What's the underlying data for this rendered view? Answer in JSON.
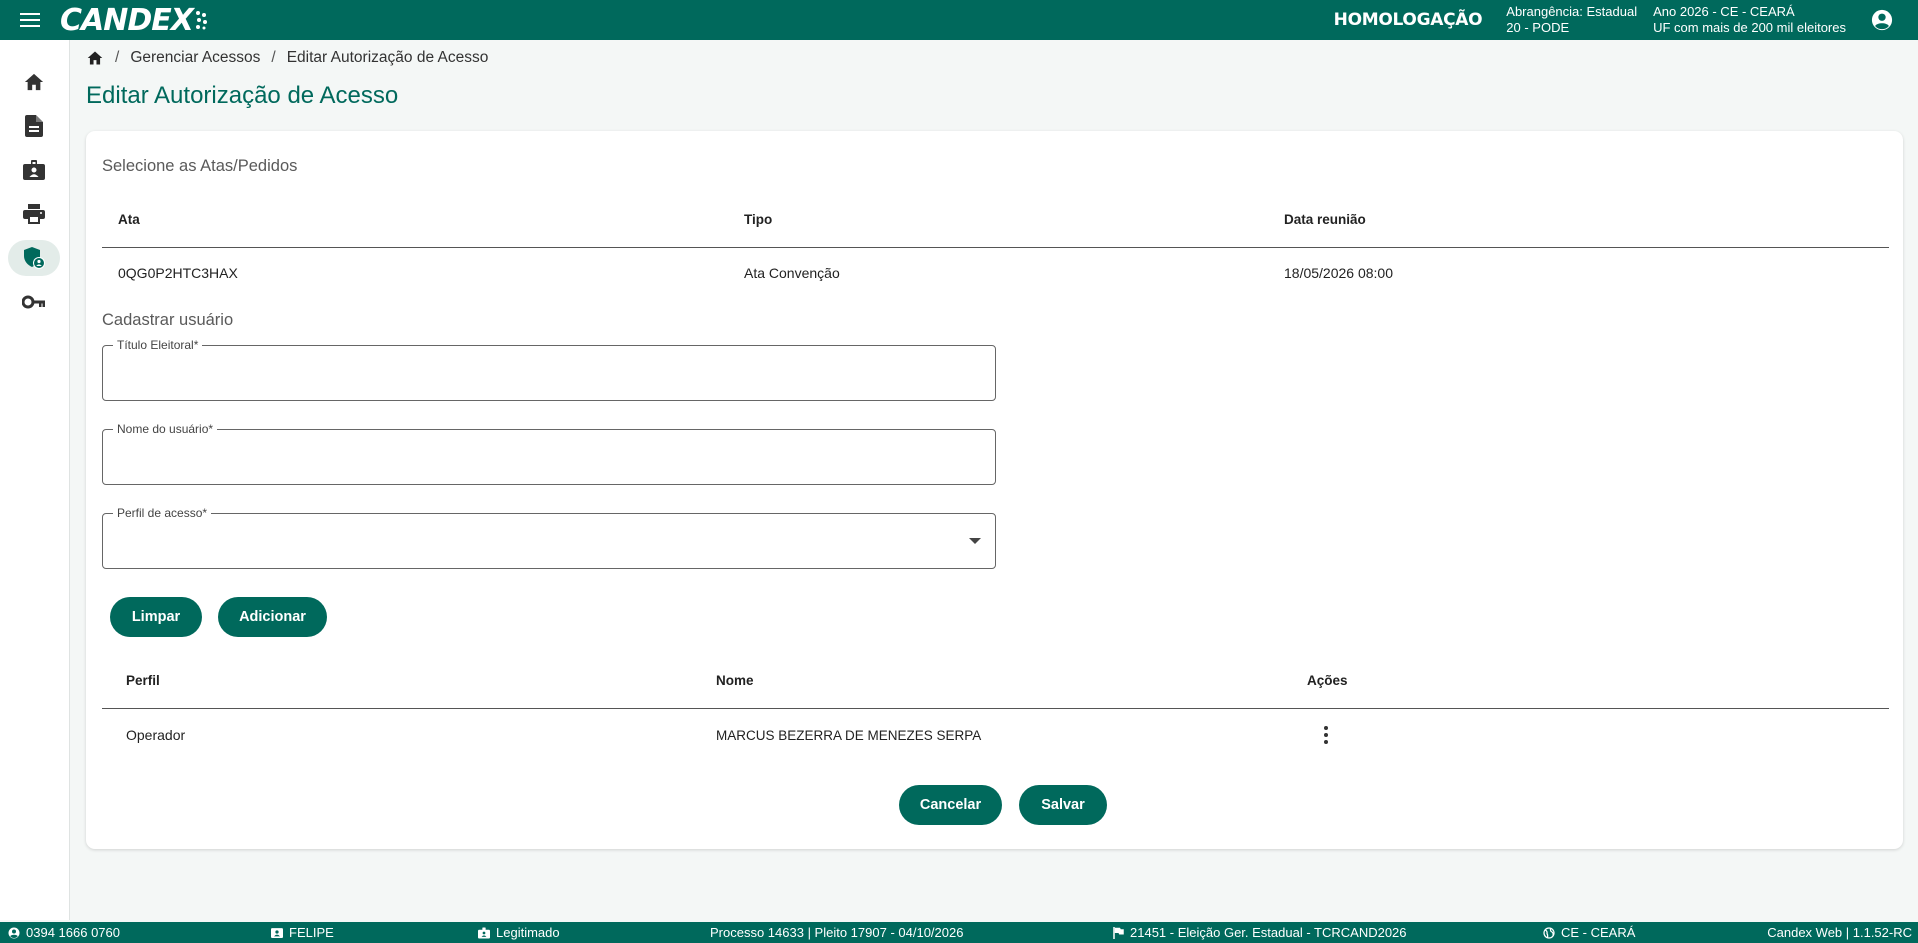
{
  "header": {
    "logo": "CANDEX",
    "environment": "HOMOLOGAÇÃO",
    "scope_line1": "Abrangência: Estadual",
    "scope_line2": "20 - PODE",
    "year_line1": "Ano 2026 - CE - CEARÁ",
    "year_line2": "UF com mais de 200 mil eleitores"
  },
  "sidebar": {
    "items": [
      {
        "icon": "home-icon"
      },
      {
        "icon": "document-icon"
      },
      {
        "icon": "badge-icon"
      },
      {
        "icon": "print-icon"
      },
      {
        "icon": "shield-user-icon",
        "active": true
      },
      {
        "icon": "key-icon"
      }
    ]
  },
  "breadcrumb": {
    "items": [
      "Gerenciar Acessos",
      "Editar Autorização de Acesso"
    ]
  },
  "page": {
    "title": "Editar Autorização de Acesso"
  },
  "atas": {
    "section_title": "Selecione as Atas/Pedidos",
    "columns": [
      "Ata",
      "Tipo",
      "Data reunião"
    ],
    "rows": [
      [
        "0QG0P2HTC3HAX",
        "Ata Convenção",
        "18/05/2026 08:00"
      ]
    ]
  },
  "form": {
    "section_title": "Cadastrar usuário",
    "titulo_label": "Título Eleitoral*",
    "titulo_value": "",
    "nome_label": "Nome do usuário*",
    "nome_value": "",
    "perfil_label": "Perfil de acesso*",
    "perfil_value": "",
    "clear_label": "Limpar",
    "add_label": "Adicionar"
  },
  "users": {
    "columns": [
      "Perfil",
      "Nome",
      "Ações"
    ],
    "rows": [
      [
        "Operador",
        "MARCUS BEZERRA DE MENEZES SERPA"
      ]
    ]
  },
  "actions": {
    "cancel_label": "Cancelar",
    "save_label": "Salvar"
  },
  "footer": {
    "phone": "0394 1666 0760",
    "user": "FELIPE",
    "status": "Legitimado",
    "process": "Processo 14633 | Pleito 17907 - 04/10/2026",
    "election": "21451 - Eleição Ger. Estadual - TCRCAND2026",
    "state": "CE - CEARÁ",
    "version": "Candex Web | 1.1.52-RC"
  },
  "colors": {
    "primary": "#00695c",
    "background": "#f4f7f6"
  }
}
